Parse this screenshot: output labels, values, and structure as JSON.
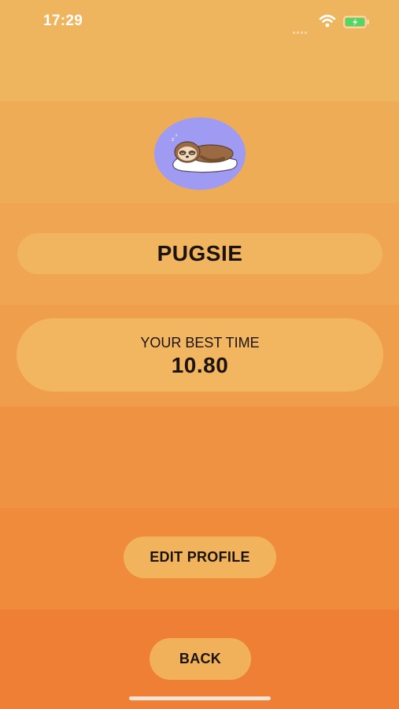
{
  "status_bar": {
    "time": "17:29",
    "icons": [
      "cellular-signal-icon",
      "wifi-icon",
      "battery-charging-icon"
    ]
  },
  "profile": {
    "avatar_icon": "sleeping-sloth-icon",
    "name": "PUGSIE"
  },
  "best_time": {
    "label": "YOUR BEST TIME",
    "value": "10.80"
  },
  "buttons": {
    "edit_profile": "EDIT PROFILE",
    "back": "BACK"
  },
  "colors": {
    "background_top": "#efb55e",
    "background_bottom": "#ee7f34",
    "pill": "#f1b45f",
    "avatar_bg": "#9f9bf3",
    "text": "#1b130e",
    "battery_green": "#4cd964"
  }
}
